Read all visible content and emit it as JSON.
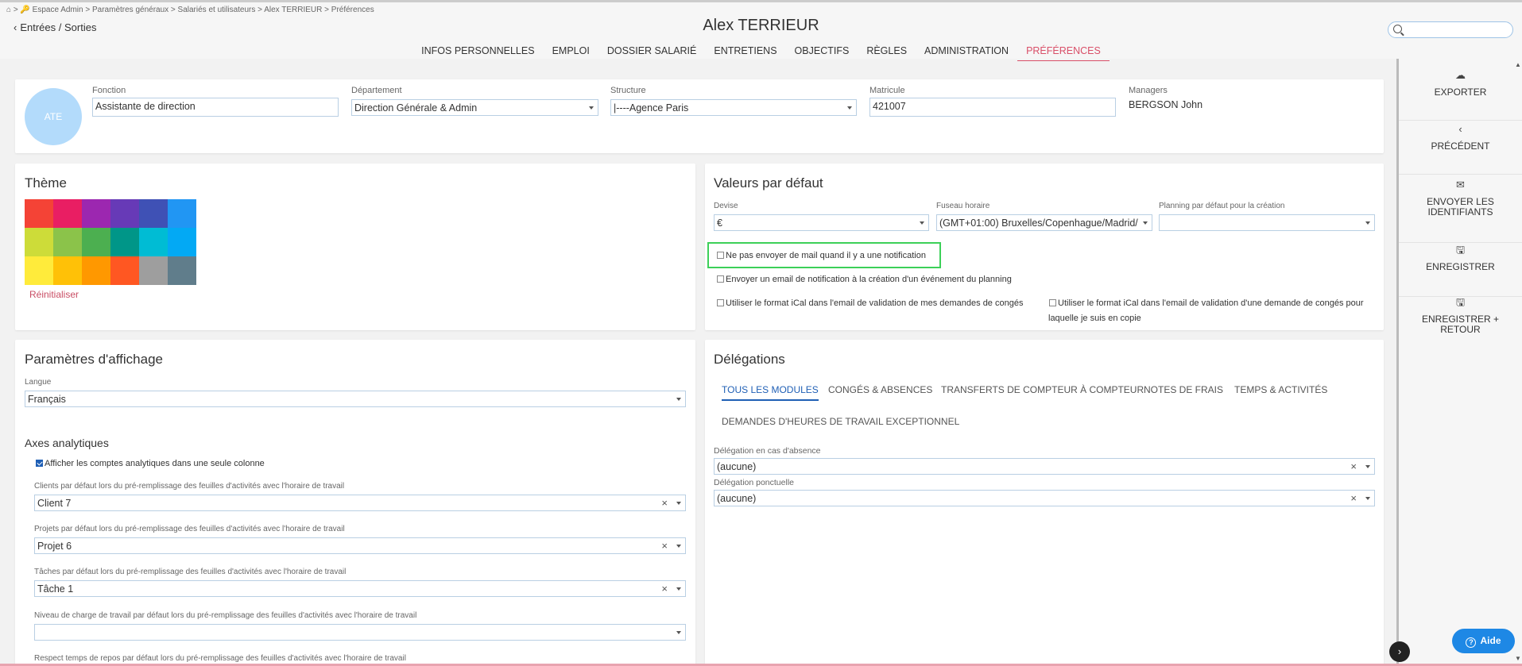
{
  "breadcrumb": "⌂ > 🔑 Espace Admin > Paramètres généraux > Salariés et utilisateurs > Alex TERRIEUR > Préférences",
  "back_link": "Entrées / Sorties",
  "page_title": "Alex TERRIEUR",
  "search": {
    "value": ""
  },
  "tabs": [
    {
      "label": "INFOS PERSONNELLES",
      "active": false
    },
    {
      "label": "EMPLOI",
      "active": false
    },
    {
      "label": "DOSSIER SALARIÉ",
      "active": false
    },
    {
      "label": "ENTRETIENS",
      "active": false
    },
    {
      "label": "OBJECTIFS",
      "active": false
    },
    {
      "label": "RÈGLES",
      "active": false
    },
    {
      "label": "ADMINISTRATION",
      "active": false
    },
    {
      "label": "PRÉFÉRENCES",
      "active": true
    }
  ],
  "header_card": {
    "avatar_initials": "ATE",
    "fonction_label": "Fonction",
    "fonction_value": "Assistante de direction",
    "departement_label": "Département",
    "departement_value": "Direction Générale & Admin",
    "structure_label": "Structure",
    "structure_value": "|----Agence Paris",
    "matricule_label": "Matricule",
    "matricule_value": "421007",
    "managers_label": "Managers",
    "managers_value": "BERGSON John"
  },
  "theme": {
    "title": "Thème",
    "colors": [
      "#f44336",
      "#e91e63",
      "#9c27b0",
      "#673ab7",
      "#3f51b5",
      "#2196f3",
      "#cddc39",
      "#8bc34a",
      "#4caf50",
      "#009688",
      "#00bcd4",
      "#03a9f4",
      "#ffeb3b",
      "#ffc107",
      "#ff9800",
      "#ff5722",
      "#9e9e9e",
      "#607d8b"
    ],
    "reset_label": "Réinitialiser"
  },
  "defaults": {
    "title": "Valeurs par défaut",
    "devise_label": "Devise",
    "devise_value": "€",
    "fuseau_label": "Fuseau horaire",
    "fuseau_value": "(GMT+01:00) Bruxelles/Copenhague/Madrid/",
    "planning_label": "Planning par défaut pour la création",
    "planning_value": "",
    "cb_no_mail": "Ne pas envoyer de mail quand il y a une notification",
    "cb_notif_planning": "Envoyer un email de notification à la création d'un événement du planning",
    "cb_ical_mine": "Utiliser le format iCal dans l'email de validation de mes demandes de congés",
    "cb_ical_copy_line1": "Utiliser le format iCal dans l'email de validation d'une demande de congés pour",
    "cb_ical_copy_line2": "laquelle je suis en copie"
  },
  "display": {
    "title": "Paramètres d'affichage",
    "langue_label": "Langue",
    "langue_value": "Français",
    "axes_title": "Axes analytiques",
    "cb_single_column": "Afficher les comptes analytiques dans une seule colonne",
    "clients_label": "Clients par défaut lors du pré-remplissage des feuilles d'activités avec l'horaire de travail",
    "clients_value": "Client 7",
    "projets_label": "Projets par défaut lors du pré-remplissage des feuilles d'activités avec l'horaire de travail",
    "projets_value": "Projet 6",
    "taches_label": "Tâches par défaut lors du pré-remplissage des feuilles d'activités avec l'horaire de travail",
    "taches_value": "Tâche 1",
    "charge_label": "Niveau de charge de travail par défaut lors du pré-remplissage des feuilles d'activités avec l'horaire de travail",
    "charge_value": "",
    "repos_label": "Respect temps de repos par défaut lors du pré-remplissage des feuilles d'activités avec l'horaire de travail"
  },
  "delegations": {
    "title": "Délégations",
    "tabs": [
      "TOUS LES MODULES",
      "CONGÉS & ABSENCES",
      "TRANSFERTS DE COMPTEUR À COMPTEUR",
      "NOTES DE FRAIS",
      "TEMPS & ACTIVITÉS",
      "DEMANDES D'HEURES DE TRAVAIL EXCEPTIONNEL"
    ],
    "absence_label": "Délégation en cas d'absence",
    "absence_value": "(aucune)",
    "ponctuelle_label": "Délégation ponctuelle",
    "ponctuelle_value": "(aucune)"
  },
  "sidebar": {
    "exporter": "EXPORTER",
    "precedent": "PRÉCÉDENT",
    "envoyer_line1": "ENVOYER LES",
    "envoyer_line2": "IDENTIFIANTS",
    "enregistrer": "ENREGISTRER",
    "enreg_retour_line1": "ENREGISTRER +",
    "enreg_retour_line2": "RETOUR"
  },
  "help_label": "Aide",
  "clear_glyph": "×"
}
